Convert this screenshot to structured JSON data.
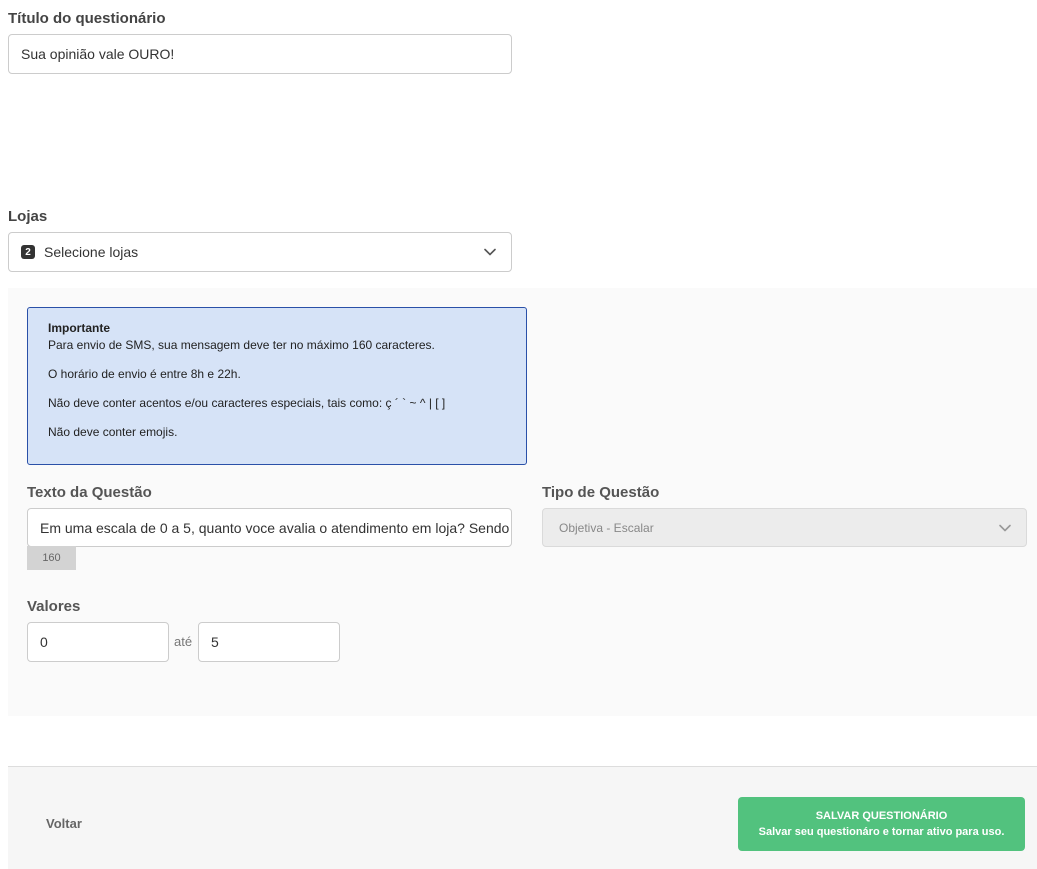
{
  "form": {
    "title_label": "Título do questionário",
    "title_value": "Sua opinião vale OURO!",
    "stores_label": "Lojas",
    "stores_count": "2",
    "stores_placeholder": "Selecione lojas"
  },
  "notice": {
    "heading": "Importante",
    "lines": [
      "Para envio de SMS, sua mensagem deve ter no máximo 160 caracteres.",
      "O horário de envio é entre 8h e 22h.",
      "Não deve conter acentos e/ou caracteres especiais, tais como: ç ´ ` ~ ^ | [ ]",
      "Não deve conter emojis."
    ]
  },
  "question": {
    "text_label": "Texto da Questão",
    "text_value": "Em uma escala de 0 a 5, quanto voce avalia o atendimento em loja? Sendo",
    "char_counter": "160",
    "type_label": "Tipo de Questão",
    "type_value": "Objetiva - Escalar",
    "values_label": "Valores",
    "min_value": "0",
    "separator": "até",
    "max_value": "5"
  },
  "footer": {
    "back_label": "Voltar",
    "save_title": "SALVAR QUESTIONÁRIO",
    "save_subtitle": "Salvar seu questionáro e tornar ativo para uso."
  },
  "colors": {
    "save_button": "#52c27e",
    "notice_background": "#d6e3f7",
    "notice_border": "#2a50a8"
  },
  "icons": [
    "chevron-down-icon"
  ]
}
